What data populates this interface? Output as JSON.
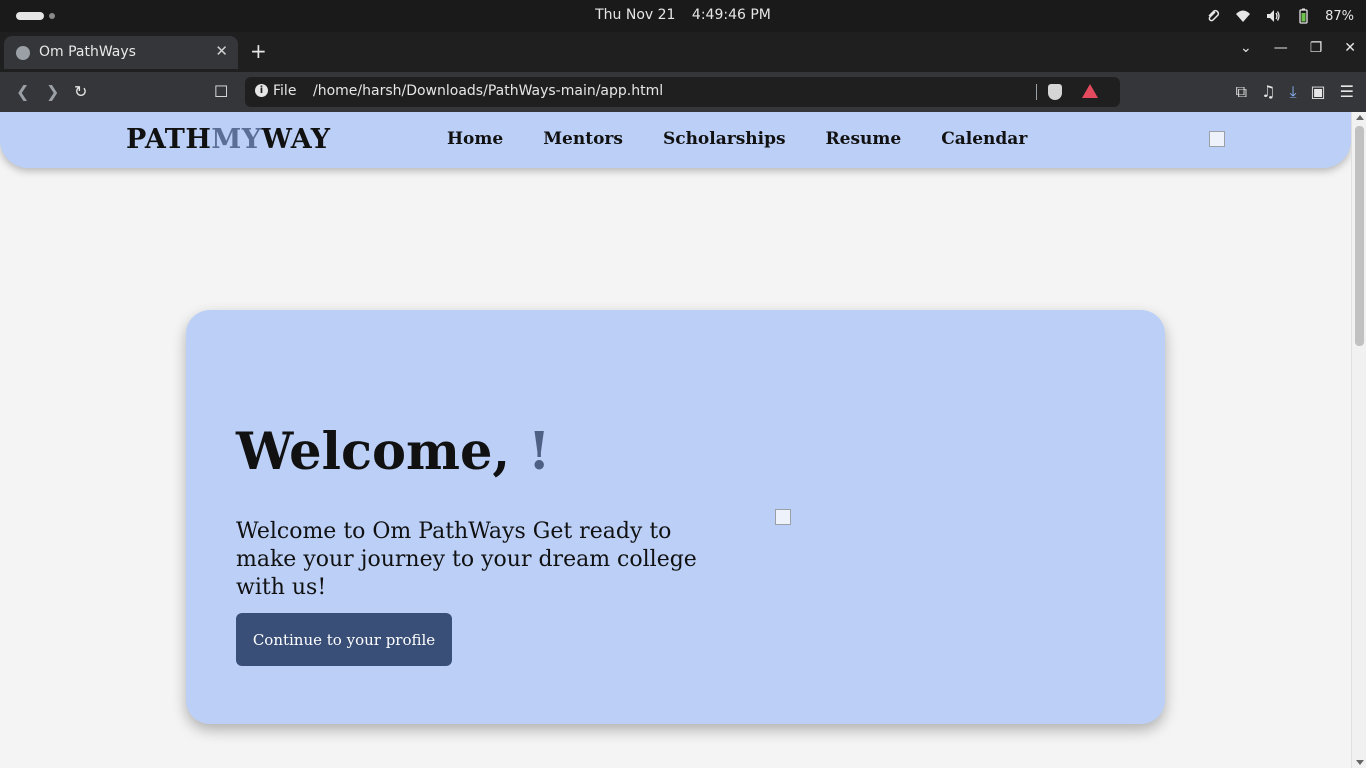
{
  "os": {
    "date": "Thu Nov 21",
    "time": "4:49:46 PM",
    "battery": "87%"
  },
  "browser": {
    "tab_title": "Om PathWays",
    "address_scheme": "File",
    "address_url": "/home/harsh/Downloads/PathWays-main/app.html"
  },
  "site": {
    "logo": {
      "part1": "PATH",
      "part2": "MY",
      "part3": "WAY"
    },
    "nav": [
      "Home",
      "Mentors",
      "Scholarships",
      "Resume",
      "Calendar"
    ],
    "hero": {
      "title": "Welcome,",
      "title_suffix": "!",
      "subtitle": "Welcome to Om PathWays Get ready to make your journey to your dream college with us!",
      "button": "Continue to your profile"
    },
    "colors": {
      "nav_bg": "#bbcff7",
      "card_bg": "#bbcff7",
      "button_bg": "#3a4f78",
      "accent": "#5a6e96"
    }
  }
}
